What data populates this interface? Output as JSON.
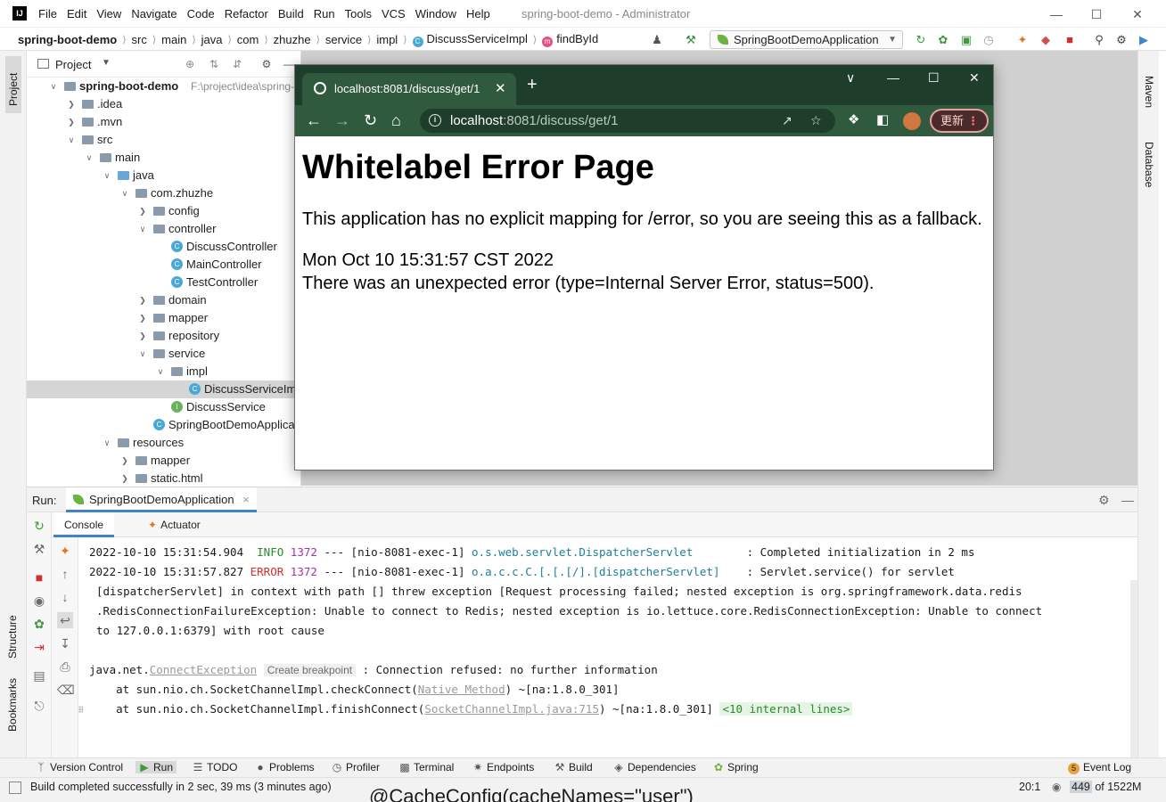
{
  "window": {
    "app_logo": "IJ",
    "title": "spring-boot-demo - Administrator",
    "menu": [
      "File",
      "Edit",
      "View",
      "Navigate",
      "Code",
      "Refactor",
      "Build",
      "Run",
      "Tools",
      "VCS",
      "Window",
      "Help"
    ]
  },
  "breadcrumb": [
    "spring-boot-demo",
    "src",
    "main",
    "java",
    "com",
    "zhuzhe",
    "service",
    "impl",
    "DiscussServiceImpl",
    "findById"
  ],
  "run_config": "SpringBootDemoApplication",
  "left_stripe": {
    "project": "Project",
    "structure": "Structure",
    "bookmarks": "Bookmarks"
  },
  "right_stripe": {
    "maven": "Maven",
    "database": "Database"
  },
  "project_panel": {
    "title": "Project",
    "tree": [
      {
        "label": "spring-boot-demo",
        "path": "F:\\project\\idea\\spring-b",
        "depth": 0,
        "arrow": "down",
        "icon": "folder"
      },
      {
        "label": ".idea",
        "depth": 1,
        "arrow": "right",
        "icon": "folder"
      },
      {
        "label": ".mvn",
        "depth": 1,
        "arrow": "right",
        "icon": "folder"
      },
      {
        "label": "src",
        "depth": 1,
        "arrow": "down",
        "icon": "folder"
      },
      {
        "label": "main",
        "depth": 2,
        "arrow": "down",
        "icon": "folder"
      },
      {
        "label": "java",
        "depth": 3,
        "arrow": "down",
        "icon": "folder-blue"
      },
      {
        "label": "com.zhuzhe",
        "depth": 4,
        "arrow": "down",
        "icon": "folder"
      },
      {
        "label": "config",
        "depth": 5,
        "arrow": "right",
        "icon": "folder"
      },
      {
        "label": "controller",
        "depth": 5,
        "arrow": "down",
        "icon": "folder"
      },
      {
        "label": "DiscussController",
        "depth": 6,
        "arrow": "",
        "icon": "class"
      },
      {
        "label": "MainController",
        "depth": 6,
        "arrow": "",
        "icon": "class"
      },
      {
        "label": "TestController",
        "depth": 6,
        "arrow": "",
        "icon": "class"
      },
      {
        "label": "domain",
        "depth": 5,
        "arrow": "right",
        "icon": "folder"
      },
      {
        "label": "mapper",
        "depth": 5,
        "arrow": "right",
        "icon": "folder"
      },
      {
        "label": "repository",
        "depth": 5,
        "arrow": "right",
        "icon": "folder"
      },
      {
        "label": "service",
        "depth": 5,
        "arrow": "down",
        "icon": "folder"
      },
      {
        "label": "impl",
        "depth": 6,
        "arrow": "down",
        "icon": "folder"
      },
      {
        "label": "DiscussServiceImpl",
        "depth": 7,
        "arrow": "",
        "icon": "class",
        "selected": true
      },
      {
        "label": "DiscussService",
        "depth": 6,
        "arrow": "",
        "icon": "interface"
      },
      {
        "label": "SpringBootDemoApplicatio",
        "depth": 5,
        "arrow": "",
        "icon": "class"
      },
      {
        "label": "resources",
        "depth": 3,
        "arrow": "down",
        "icon": "folder"
      },
      {
        "label": "mapper",
        "depth": 4,
        "arrow": "right",
        "icon": "folder"
      },
      {
        "label": "static.html",
        "depth": 4,
        "arrow": "right",
        "icon": "folder"
      }
    ]
  },
  "browser": {
    "tab_title": "localhost:8081/discuss/get/1",
    "url_host": "localhost",
    "url_rest": ":8081/discuss/get/1",
    "update_button": "更新",
    "page": {
      "heading": "Whitelabel Error Page",
      "message": "This application has no explicit mapping for /error, so you are seeing this as a fallback.",
      "timestamp": "Mon Oct 10 15:31:57 CST 2022",
      "error_line": "There was an unexpected error (type=Internal Server Error, status=500)."
    }
  },
  "run_panel": {
    "label": "Run:",
    "tab": "SpringBootDemoApplication",
    "console_tab": "Console",
    "actuator_tab": "Actuator",
    "log": {
      "l1_ts": "2022-10-10 15:31:54.904",
      "l1_level": "INFO",
      "l1_pid": "1372",
      "l1_thread": "--- [nio-8081-exec-1]",
      "l1_logger": "o.s.web.servlet.DispatcherServlet",
      "l1_msg": ": Completed initialization in 2 ms",
      "l2_ts": "2022-10-10 15:31:57.827",
      "l2_level": "ERROR",
      "l2_pid": "1372",
      "l2_thread": "--- [nio-8081-exec-1]",
      "l2_logger": "o.a.c.c.C.[.[.[/].[dispatcherServlet]",
      "l2_msg": ": Servlet.service() for servlet",
      "l3": "[dispatcherServlet] in context with path [] threw exception [Request processing failed; nested exception is org.springframework.data.redis",
      "l4": ".RedisConnectionFailureException: Unable to connect to Redis; nested exception is io.lettuce.core.RedisConnectionException: Unable to connect",
      "l5": "to 127.0.0.1:6379] with root cause",
      "l6_prefix": "java.net.",
      "l6_link": "ConnectException",
      "l6_hint": "Create breakpoint",
      "l6_msg": ": Connection refused: no further information",
      "l7_prefix": "    at sun.nio.ch.SocketChannelImpl.checkConnect(",
      "l7_link": "Native Method",
      "l7_suffix": ") ~[na:1.8.0_301]",
      "l8_prefix": "    at sun.nio.ch.SocketChannelImpl.finishConnect(",
      "l8_link": "SocketChannelImpl.java:715",
      "l8_suffix": ") ~[na:1.8.0_301]",
      "l8_internal": "<10 internal lines>"
    }
  },
  "bottom_tools": [
    "Version Control",
    "Run",
    "TODO",
    "Problems",
    "Profiler",
    "Terminal",
    "Endpoints",
    "Build",
    "Dependencies",
    "Spring"
  ],
  "event_log": {
    "count": "5",
    "label": "Event Log"
  },
  "status": {
    "message": "Build completed successfully in 2 sec, 39 ms (3 minutes ago)",
    "position": "20:1",
    "mem_used": "449",
    "mem_total": " of 1522M",
    "ghost_text": "@CacheConfig(cacheNames=\"user\")"
  }
}
